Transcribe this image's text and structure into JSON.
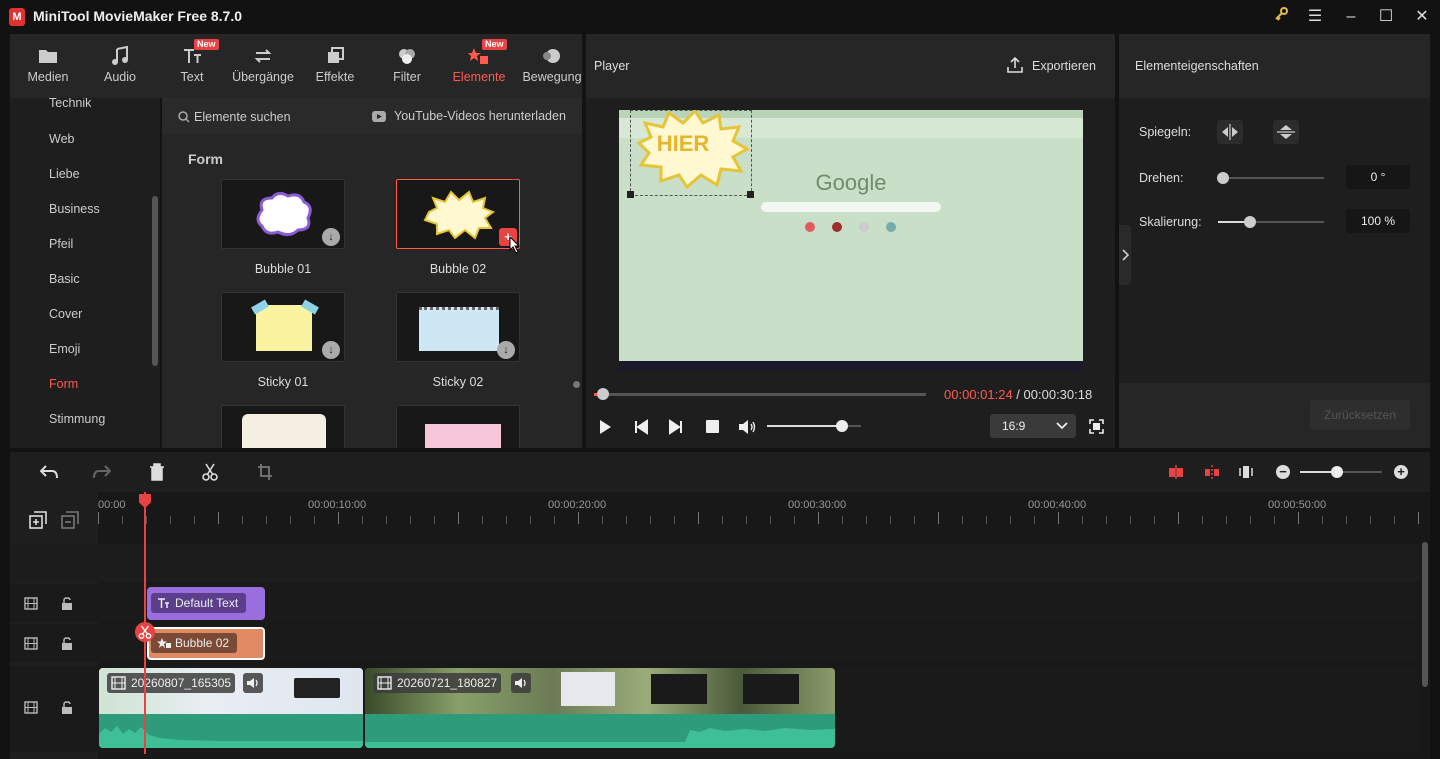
{
  "app": {
    "title": "MiniTool MovieMaker Free 8.7.0"
  },
  "toolbar": {
    "items": [
      {
        "label": "Medien",
        "icon": "folder-icon"
      },
      {
        "label": "Audio",
        "icon": "music-note-icon"
      },
      {
        "label": "Text",
        "icon": "text-icon",
        "badge": "New"
      },
      {
        "label": "Übergänge",
        "icon": "transition-arrows-icon"
      },
      {
        "label": "Effekte",
        "icon": "effects-icon"
      },
      {
        "label": "Filter",
        "icon": "filter-icon"
      },
      {
        "label": "Elemente",
        "icon": "elements-icon",
        "badge": "New",
        "active": true
      },
      {
        "label": "Bewegung",
        "icon": "motion-icon"
      }
    ]
  },
  "categories": {
    "items": [
      "Technik",
      "Web",
      "Liebe",
      "Business",
      "Pfeil",
      "Basic",
      "Cover",
      "Emoji",
      "Form",
      "Stimmung"
    ],
    "active": "Form"
  },
  "library": {
    "search_label": "Elemente suchen",
    "youtube_label": "YouTube-Videos herunterladen",
    "section_title": "Form",
    "items": [
      {
        "label": "Bubble 01"
      },
      {
        "label": "Bubble 02",
        "selected": true
      },
      {
        "label": "Sticky 01"
      },
      {
        "label": "Sticky 02"
      }
    ]
  },
  "player": {
    "title": "Player",
    "export_label": "Exportieren",
    "current_time": "00:00:01:24",
    "separator": " / ",
    "total_time": "00:00:30:18",
    "aspect_ratio": "16:9",
    "progress": 0.028,
    "volume": 0.8,
    "preview": {
      "sticker_text": "HIER",
      "google_logo": "Google"
    }
  },
  "properties": {
    "title": "Elementeigenschaften",
    "mirror_label": "Spiegeln:",
    "rotate_label": "Drehen:",
    "rotate_value": "0 °",
    "rotate_level": 0.05,
    "scale_label": "Skalierung:",
    "scale_value": "100 %",
    "scale_level": 0.3,
    "reset_label": "Zurücksetzen"
  },
  "timeline": {
    "time_labels": [
      "00:00",
      "00:00:10:00",
      "00:00:20:00",
      "00:00:30:00",
      "00:00:40:00",
      "00:00:50:00"
    ],
    "clips": {
      "text_clip": "Default Text",
      "element_clip": "Bubble 02",
      "video1": "20260807_165305",
      "video2": "20260721_180827"
    },
    "zoom_level": 0.45
  },
  "colors": {
    "accent": "#ff5a4e",
    "text_clip": "#9b6ee0",
    "element_clip": "#e08a63",
    "audio": "#2e9c7a"
  }
}
